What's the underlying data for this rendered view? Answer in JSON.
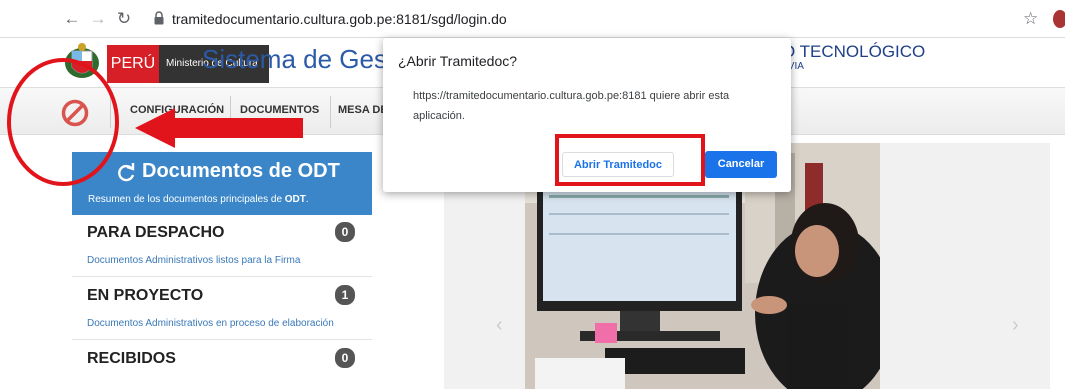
{
  "browser": {
    "url": "tramitedocumentario.cultura.gob.pe:8181/sgd/login.do",
    "icons": [
      "back-icon",
      "forward-icon",
      "reload-icon",
      "lock-icon",
      "star-icon"
    ]
  },
  "header": {
    "peru_label": "PERÚ",
    "ministry_label": "Ministerio de Cultura",
    "system_title": "Sistema de Gestión Documental",
    "right_title": "O TECNOLÓGICO",
    "right_subtitle": "IVIA"
  },
  "menu": {
    "items": [
      "CONFIGURACIÓN",
      "DOCUMENTOS",
      "MESA DE"
    ]
  },
  "panel": {
    "title": "Documentos de ODT",
    "subtitle_prefix": "Resumen de los documentos principales de ",
    "subtitle_bold": "ODT",
    "subtitle_suffix": ".",
    "cards": [
      {
        "title": "PARA DESPACHO",
        "count": "0",
        "desc": "Documentos Administrativos listos para la Firma"
      },
      {
        "title": "EN PROYECTO",
        "count": "1",
        "desc": "Documentos Administrativos en proceso de elaboración"
      },
      {
        "title": "RECIBIDOS",
        "count": "0",
        "desc": ""
      }
    ]
  },
  "dialog": {
    "title": "¿Abrir Tramitedoc?",
    "message": "https://tramitedocumentario.cultura.gob.pe:8181 quiere abrir esta aplicación.",
    "open_label": "Abrir Tramitedoc",
    "cancel_label": "Cancelar"
  },
  "colors": {
    "accent_blue": "#1a73e8",
    "panel_blue": "#3a86c8",
    "annotation_red": "#e2141b"
  }
}
